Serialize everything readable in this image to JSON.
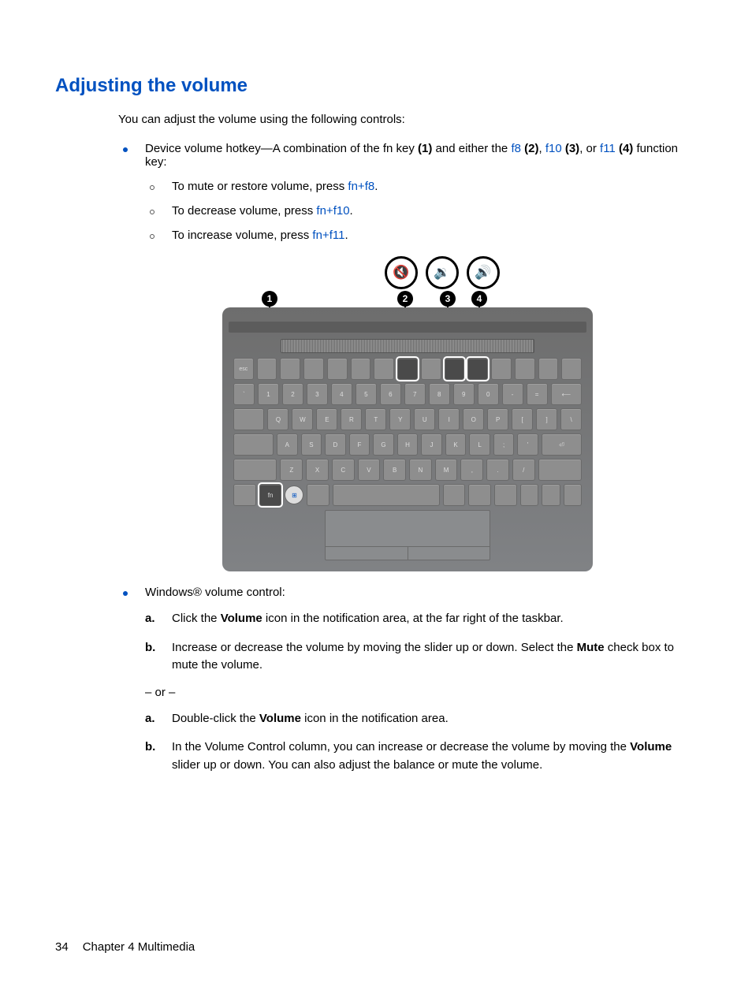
{
  "heading": "Adjusting the volume",
  "intro": "You can adjust the volume using the following controls:",
  "bullet1": {
    "pre": "Device volume hotkey—A combination of the fn key ",
    "b1": "(1)",
    "mid1": " and either the ",
    "l_f8": "f8",
    "sp": " ",
    "b2": "(2)",
    "mid2": ", ",
    "l_f10": "f10",
    "b3": "(3)",
    "mid3": ", or ",
    "l_f11": "f11",
    "b4": "(4)",
    "post": " function key:"
  },
  "sub_mute": {
    "pre": "To mute or restore volume, press ",
    "link": "fn+f8",
    "post": "."
  },
  "sub_dec": {
    "pre": "To decrease volume, press ",
    "link": "fn+f10",
    "post": "."
  },
  "sub_inc": {
    "pre": "To increase volume, press ",
    "link": "fn+f11",
    "post": "."
  },
  "icons": {
    "mute": "🔇",
    "down": "🔉",
    "up": "🔊"
  },
  "badges": {
    "b1": "1",
    "b2": "2",
    "b3": "3",
    "b4": "4"
  },
  "bullet2_lead": "Windows® volume control:",
  "steps1": {
    "a": {
      "m": "a.",
      "pre": "Click the ",
      "bold": "Volume",
      "post": " icon in the notification area, at the far right of the taskbar."
    },
    "b": {
      "m": "b.",
      "pre": "Increase or decrease the volume by moving the slider up or down. Select the ",
      "bold": "Mute",
      "post": " check box to mute the volume."
    }
  },
  "or": "– or –",
  "steps2": {
    "a": {
      "m": "a.",
      "pre": "Double-click the ",
      "bold": "Volume",
      "post": " icon in the notification area."
    },
    "b": {
      "m": "b.",
      "pre": "In the Volume Control column, you can increase or decrease the volume by moving the ",
      "bold": "Volume",
      "post": " slider up or down. You can also adjust the balance or mute the volume."
    }
  },
  "footer": {
    "page": "34",
    "chapter": "Chapter 4   Multimedia"
  }
}
